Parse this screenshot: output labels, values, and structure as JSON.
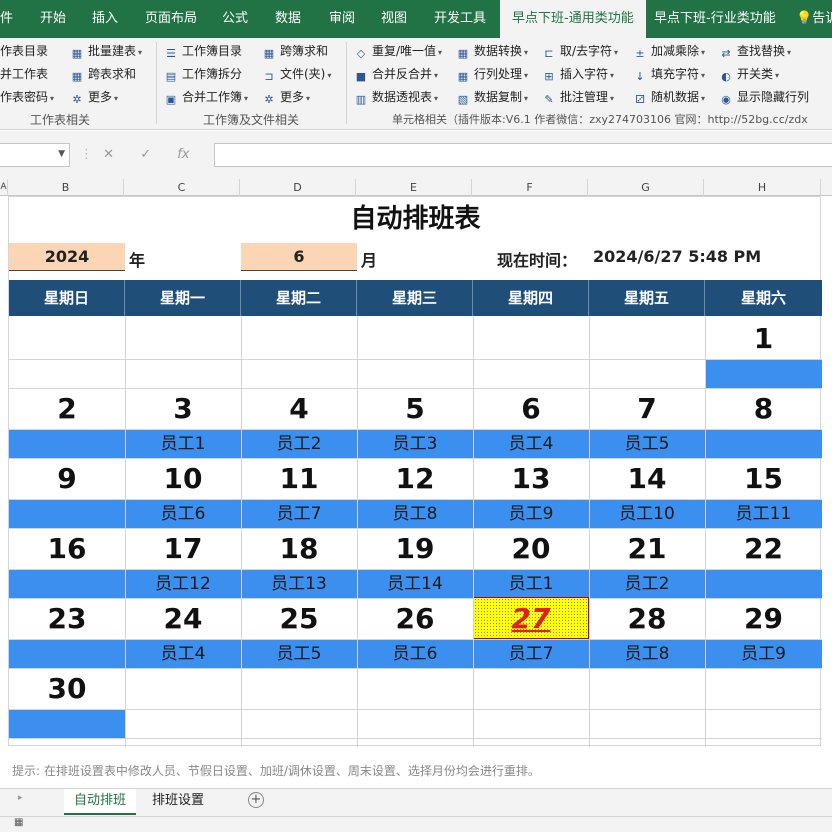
{
  "tabs": [
    "件",
    "开始",
    "插入",
    "页面布局",
    "公式",
    "数据",
    "审阅",
    "视图",
    "开发工具",
    "早点下班-通用类功能",
    "早点下班-行业类功能",
    "告诉"
  ],
  "ribbon": {
    "g1": [
      "作表目录",
      "并工作表",
      "作表密码"
    ],
    "g2": [
      "批量建表",
      "跨表求和",
      "更多"
    ],
    "g3": [
      "工作簿目录",
      "工作簿拆分",
      "合并工作簿"
    ],
    "g4": [
      "跨簿求和",
      "文件(夹)",
      "更多"
    ],
    "g5": [
      "重复/唯一值",
      "合并反合并",
      "数据透视表"
    ],
    "g6": [
      "数据转换",
      "行列处理",
      "数据复制"
    ],
    "g7": [
      "取/去字符",
      "插入字符",
      "批注管理"
    ],
    "g8": [
      "加减乘除",
      "填充字符",
      "随机数据"
    ],
    "g9": [
      "查找替换",
      "开关类",
      "显示隐藏行列"
    ],
    "group1_label": "工作表相关",
    "group2_label": "工作簿及文件相关",
    "group3_label": "单元格相关（插件版本:V6.1 作者微信：zxy274703106 官网：http://52bg.cc/zdx"
  },
  "columns": [
    "A",
    "B",
    "C",
    "D",
    "E",
    "F",
    "G",
    "H"
  ],
  "sheet": {
    "title": "自动排班表",
    "year": "2024",
    "year_unit": "年",
    "month": "6",
    "month_unit": "月",
    "now_label": "现在时间：",
    "now_value": "2024/6/27 5:48 PM",
    "weekdays": [
      "星期日",
      "星期一",
      "星期二",
      "星期三",
      "星期四",
      "星期五",
      "星期六"
    ],
    "weeks": [
      {
        "days": [
          "",
          "",
          "",
          "",
          "",
          "",
          "1"
        ],
        "staff": [
          "",
          "",
          "",
          "",
          "",
          "",
          ""
        ]
      },
      {
        "days": [
          "2",
          "3",
          "4",
          "5",
          "6",
          "7",
          "8"
        ],
        "staff": [
          "",
          "员工1",
          "员工2",
          "员工3",
          "员工4",
          "员工5",
          ""
        ]
      },
      {
        "days": [
          "9",
          "10",
          "11",
          "12",
          "13",
          "14",
          "15"
        ],
        "staff": [
          "",
          "员工6",
          "员工7",
          "员工8",
          "员工9",
          "员工10",
          "员工11"
        ]
      },
      {
        "days": [
          "16",
          "17",
          "18",
          "19",
          "20",
          "21",
          "22"
        ],
        "staff": [
          "",
          "员工12",
          "员工13",
          "员工14",
          "员工1",
          "员工2",
          ""
        ]
      },
      {
        "days": [
          "23",
          "24",
          "25",
          "26",
          "27",
          "28",
          "29"
        ],
        "staff": [
          "",
          "员工4",
          "员工5",
          "员工6",
          "员工7",
          "员工8",
          "员工9"
        ]
      },
      {
        "days": [
          "30",
          "",
          "",
          "",
          "",
          "",
          ""
        ],
        "staff": [
          "",
          "",
          "",
          "",
          "",
          "",
          ""
        ]
      }
    ],
    "today": "27"
  },
  "hint": "提示: 在排班设置表中修改人员、节假日设置、加班/调休设置、周末设置、选择月份均会进行重排。",
  "sheet_tabs": [
    "自动排班",
    "排班设置"
  ]
}
